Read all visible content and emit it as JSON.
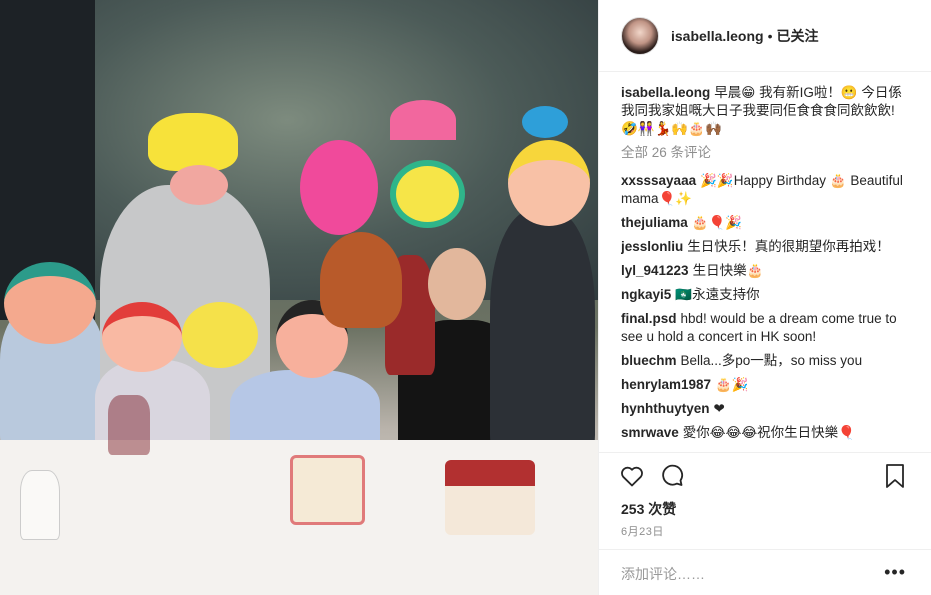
{
  "header": {
    "username": "isabella.leong",
    "separator": "•",
    "follow_status": "已关注"
  },
  "caption": {
    "username": "isabella.leong",
    "text": "早晨😁 我有新IG啦！😬 今日係我同我家姐嘅大日子我要同佢食食食同飲飲飲!🤣👭💃🙌🎂🙌🏾"
  },
  "view_all_comments": "全部 26 条评论",
  "comments": [
    {
      "user": "xxsssayaaa",
      "text": "🎉🎉Happy Birthday 🎂 Beautiful mama🎈✨"
    },
    {
      "user": "thejuliama",
      "text": "🎂🎈🎉"
    },
    {
      "user": "jesslonliu",
      "text": "生日快乐！真的很期望你再拍戏！"
    },
    {
      "user": "lyl_941223",
      "text": "生日快樂🎂"
    },
    {
      "user": "ngkayi5",
      "text": "🇲🇴永遠支持你"
    },
    {
      "user": "final.psd",
      "text": "hbd! would be a dream come true to see u hold a concert in HK soon!"
    },
    {
      "user": "bluechm",
      "text": "Bella...多po一點，so miss you"
    },
    {
      "user": "henrylam1987",
      "text": "🎂🎉"
    },
    {
      "user": "hynhthuytyen",
      "text": "❤"
    },
    {
      "user": "smrwave",
      "text": "愛你😂😂😂祝你生日快樂🎈"
    }
  ],
  "post": {
    "likes": "253 次赞",
    "date": "6月23日"
  },
  "add_comment": {
    "placeholder": "添加评论……",
    "more_label": "•••"
  }
}
